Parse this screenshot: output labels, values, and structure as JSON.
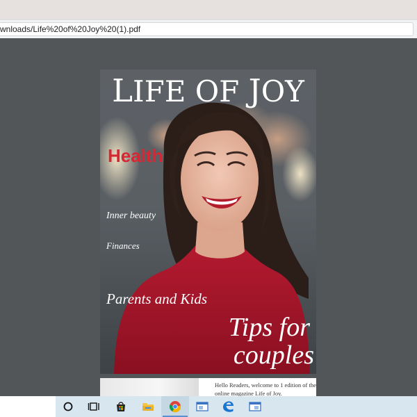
{
  "address_bar": {
    "url": "wnloads/Life%20of%20Joy%20(1).pdf"
  },
  "pdf": {
    "page1": {
      "title_l": "L",
      "title_ife": "IFE OF ",
      "title_j": "J",
      "title_oy": "OY",
      "cover_lines": {
        "health": "Health",
        "inner_beauty": "Inner beauty",
        "finances": "Finances",
        "parents_kids": "Parents and Kids",
        "tips_for": "Tips for",
        "couples": "couples"
      },
      "colors": {
        "health_red": "#d62833",
        "sweater_red": "#a8162a"
      }
    },
    "page2": {
      "intro_text": "Hello Readers, welcome to 1 edition of the online magazine Life of Joy."
    }
  },
  "taskbar": {
    "icons": [
      "cortana-circle-icon",
      "task-view-icon",
      "microsoft-store-icon",
      "file-explorer-icon",
      "chrome-icon",
      "app-window-icon",
      "edge-icon",
      "app-window-icon-2"
    ],
    "active": "chrome-icon"
  }
}
